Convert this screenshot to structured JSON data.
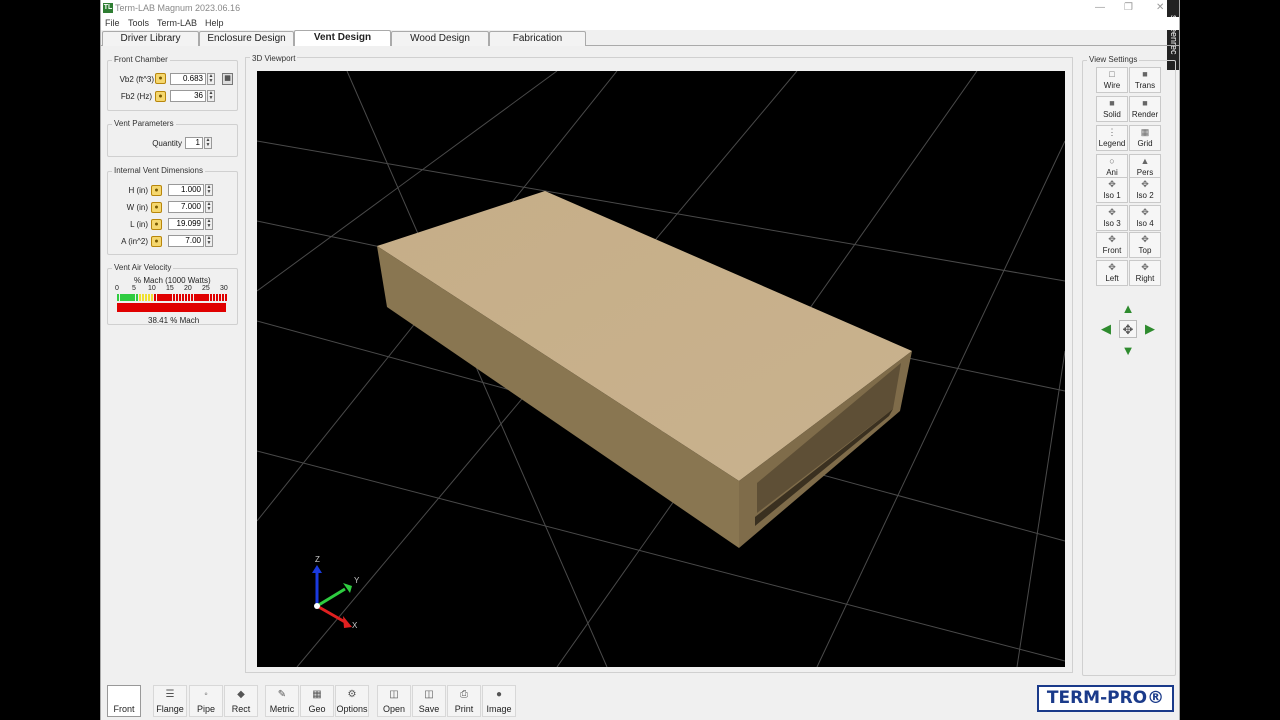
{
  "window": {
    "title": "Term-LAB Magnum 2023.06.16",
    "icon_text": "TL",
    "recorder_text": "screenrec"
  },
  "menu": [
    "File",
    "Tools",
    "Term-LAB",
    "Help"
  ],
  "tabs": [
    {
      "label": "Driver Library",
      "active": false
    },
    {
      "label": "Enclosure Design",
      "active": false
    },
    {
      "label": "Vent Design",
      "active": true
    },
    {
      "label": "Wood Design",
      "active": false
    },
    {
      "label": "Fabrication",
      "active": false
    }
  ],
  "front_chamber": {
    "title": "Front Chamber",
    "vb2_label": "Vb2 (ft^3)",
    "vb2_value": "0.683",
    "fb2_label": "Fb2 (Hz)",
    "fb2_value": "36"
  },
  "vent_parameters": {
    "title": "Vent Parameters",
    "quantity_label": "Quantity",
    "quantity_value": "1"
  },
  "internal_dims": {
    "title": "Internal Vent Dimensions",
    "h_label": "H (in)",
    "h_value": "1.000",
    "w_label": "W (in)",
    "w_value": "7.000",
    "l_label": "L (in)",
    "l_value": "19.099",
    "a_label": "A (in^2)",
    "a_value": "7.00"
  },
  "velocity": {
    "title": "Vent Air Velocity",
    "scale_label": "% Mach (1000 Watts)",
    "ticks": [
      "0",
      "5",
      "10",
      "15",
      "20",
      "25",
      "30"
    ],
    "value_percent": 38.41,
    "readout": "38.41 % Mach"
  },
  "viewport": {
    "title": "3D Viewport",
    "axis_z": "Z",
    "axis_y": "Y",
    "axis_x": "X",
    "box_color": "#c4ad86"
  },
  "view_settings": {
    "title": "View Settings",
    "buttons": [
      {
        "label": "Wire",
        "icon": "wire-icon"
      },
      {
        "label": "Trans",
        "icon": "trans-icon"
      },
      {
        "label": "Solid",
        "icon": "solid-icon"
      },
      {
        "label": "Render",
        "icon": "render-icon"
      },
      {
        "label": "Legend",
        "icon": "legend-icon"
      },
      {
        "label": "Grid",
        "icon": "grid-icon"
      },
      {
        "label": "Ani",
        "icon": "ani-icon"
      },
      {
        "label": "Pers",
        "icon": "pers-icon"
      },
      {
        "label": "Iso 1",
        "icon": "iso1-icon"
      },
      {
        "label": "Iso 2",
        "icon": "iso2-icon"
      },
      {
        "label": "Iso 3",
        "icon": "iso3-icon"
      },
      {
        "label": "Iso 4",
        "icon": "iso4-icon"
      },
      {
        "label": "Front",
        "icon": "front-view-icon"
      },
      {
        "label": "Top",
        "icon": "top-view-icon"
      },
      {
        "label": "Left",
        "icon": "left-view-icon"
      },
      {
        "label": "Right",
        "icon": "right-view-icon"
      }
    ]
  },
  "toolbar": {
    "buttons": [
      {
        "label": "Front",
        "icon": "front-icon"
      },
      {
        "label": "Flange",
        "icon": "flange-icon"
      },
      {
        "label": "Pipe",
        "icon": "pipe-icon"
      },
      {
        "label": "Rect",
        "icon": "rect-icon"
      },
      {
        "label": "Metric",
        "icon": "metric-icon"
      },
      {
        "label": "Geo",
        "icon": "geo-icon"
      },
      {
        "label": "Options",
        "icon": "options-icon"
      },
      {
        "label": "Open",
        "icon": "open-icon"
      },
      {
        "label": "Save",
        "icon": "save-icon"
      },
      {
        "label": "Print",
        "icon": "print-icon"
      },
      {
        "label": "Image",
        "icon": "image-icon"
      }
    ]
  },
  "logo": "TERM-PRO®",
  "colors": {
    "accent_green": "#2e8b2e",
    "meter_red": "#e00000",
    "meter_green": "#2ecc40",
    "meter_yellow": "#f0e030"
  }
}
